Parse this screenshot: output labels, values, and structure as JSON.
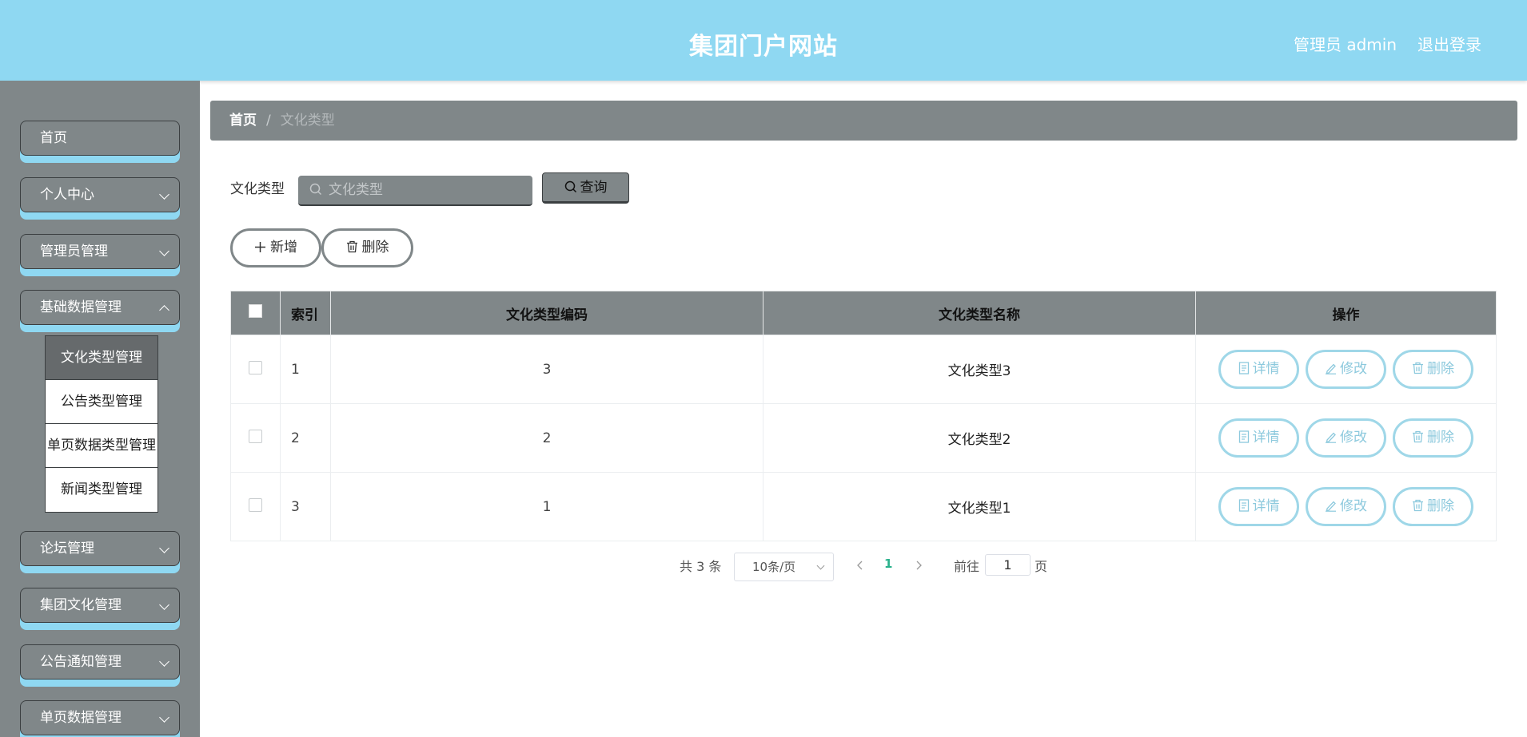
{
  "header": {
    "title": "集团门户网站",
    "user": "管理员 admin",
    "logout": "退出登录"
  },
  "sidebar": {
    "items": [
      {
        "label": "首页",
        "has_arrow": false
      },
      {
        "label": "个人中心",
        "has_arrow": true
      },
      {
        "label": "管理员管理",
        "has_arrow": true
      },
      {
        "label": "基础数据管理",
        "has_arrow": true,
        "expanded": true
      },
      {
        "label": "论坛管理",
        "has_arrow": true
      },
      {
        "label": "集团文化管理",
        "has_arrow": true
      },
      {
        "label": "公告通知管理",
        "has_arrow": true
      },
      {
        "label": "单页数据管理",
        "has_arrow": true
      }
    ],
    "submenu": [
      {
        "label": "文化类型管理",
        "active": true
      },
      {
        "label": "公告类型管理",
        "active": false
      },
      {
        "label": "单页数据类型管理",
        "active": false
      },
      {
        "label": "新闻类型管理",
        "active": false
      }
    ]
  },
  "breadcrumb": {
    "home": "首页",
    "separator": "/",
    "current": "文化类型"
  },
  "search": {
    "label": "文化类型",
    "placeholder": "文化类型",
    "button": "查询"
  },
  "actions": {
    "add": "新增",
    "delete": "删除"
  },
  "table": {
    "headers": [
      "索引",
      "文化类型编码",
      "文化类型名称",
      "操作"
    ],
    "rows": [
      {
        "index": "1",
        "code": "3",
        "name": "文化类型3"
      },
      {
        "index": "2",
        "code": "2",
        "name": "文化类型2"
      },
      {
        "index": "3",
        "code": "1",
        "name": "文化类型1"
      }
    ],
    "row_actions": {
      "detail": "详情",
      "edit": "修改",
      "delete": "删除"
    }
  },
  "pagination": {
    "total": "共 3 条",
    "page_size": "10条/页",
    "current_page": "1",
    "goto_label": "前往",
    "goto_value": "1",
    "goto_suffix": "页"
  },
  "colors": {
    "header_bg": "#8fd8f2",
    "sidebar_bg": "#808789",
    "accent_page": "#2ab18c",
    "op_button_border": "#9fd7e8"
  }
}
